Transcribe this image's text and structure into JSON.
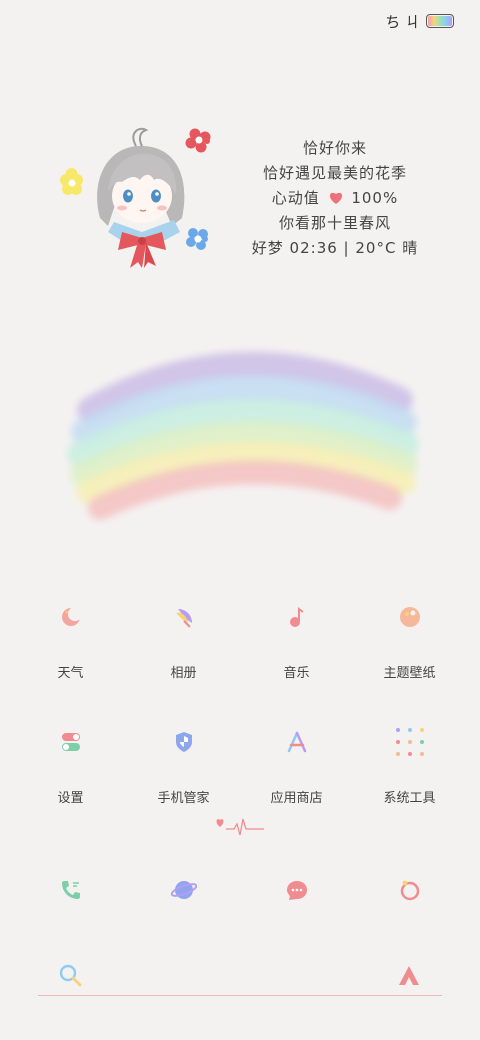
{
  "status_bar": {
    "glyphs": "ち  ㄐ",
    "battery_icon": "rainbow-battery-icon"
  },
  "widget": {
    "lines": [
      "恰好你来",
      "恰好遇见最美的花季"
    ],
    "heart_line": {
      "prefix": "心动值",
      "value": "100%"
    },
    "line4": "你看那十里春风",
    "line5": "好梦 02:36 | 20°C 晴"
  },
  "apps_row1": [
    {
      "label": "天气",
      "icon": "moon-weather-icon"
    },
    {
      "label": "相册",
      "icon": "feather-album-icon"
    },
    {
      "label": "音乐",
      "icon": "music-note-icon"
    },
    {
      "label": "主题壁纸",
      "icon": "palette-icon"
    }
  ],
  "apps_row2": [
    {
      "label": "设置",
      "icon": "toggle-settings-icon"
    },
    {
      "label": "手机管家",
      "icon": "shield-icon"
    },
    {
      "label": "应用商店",
      "icon": "app-store-icon"
    },
    {
      "label": "系统工具",
      "icon": "dot-grid-icon"
    }
  ],
  "dock": [
    {
      "icon": "phone-icon"
    },
    {
      "icon": "planet-browser-icon"
    },
    {
      "icon": "message-bubble-icon"
    },
    {
      "icon": "camera-icon"
    }
  ],
  "colors": {
    "accent_pink": "#f08c8f",
    "background": "#f4f2f1"
  }
}
